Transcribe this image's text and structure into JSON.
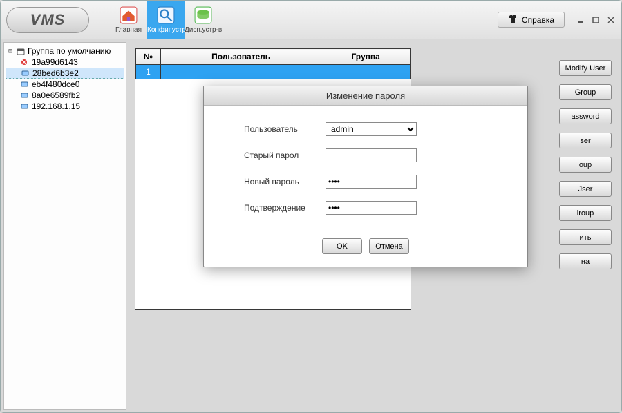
{
  "logo": "VMS",
  "toolbar_tabs": {
    "home": {
      "label": "Главная"
    },
    "config": {
      "label": "Конфиг.устр-ва"
    },
    "disp": {
      "label": "Дисп.устр-в"
    }
  },
  "help_label": "Справка",
  "tree": {
    "root_label": "Группа по умолчанию",
    "items": [
      {
        "label": "19a99d6143"
      },
      {
        "label": "28bed6b3e2"
      },
      {
        "label": "eb4f480dce0"
      },
      {
        "label": "8a0e6589fb2"
      },
      {
        "label": "192.168.1.15"
      }
    ]
  },
  "table": {
    "headers": {
      "num": "№",
      "user": "Пользователь",
      "group": "Группа"
    },
    "rows": [
      {
        "num": "1",
        "user": "",
        "group": ""
      }
    ]
  },
  "side_buttons": {
    "modify_user": "Modify User",
    "group": "Group",
    "password": "assword",
    "user": "ser",
    "group2": "oup",
    "user2": "Jser",
    "group3": "iroup",
    "apply": "ить",
    "close": "на"
  },
  "modal": {
    "title": "Изменение пароля",
    "fields": {
      "user_label": "Пользователь",
      "user_value": "admin",
      "old_label": "Старый  парол",
      "old_value": "",
      "new_label": "Новый пароль",
      "new_value": "",
      "confirm_label": "Подтверждение",
      "confirm_value": ""
    },
    "ok": "OK",
    "cancel": "Отмена"
  }
}
